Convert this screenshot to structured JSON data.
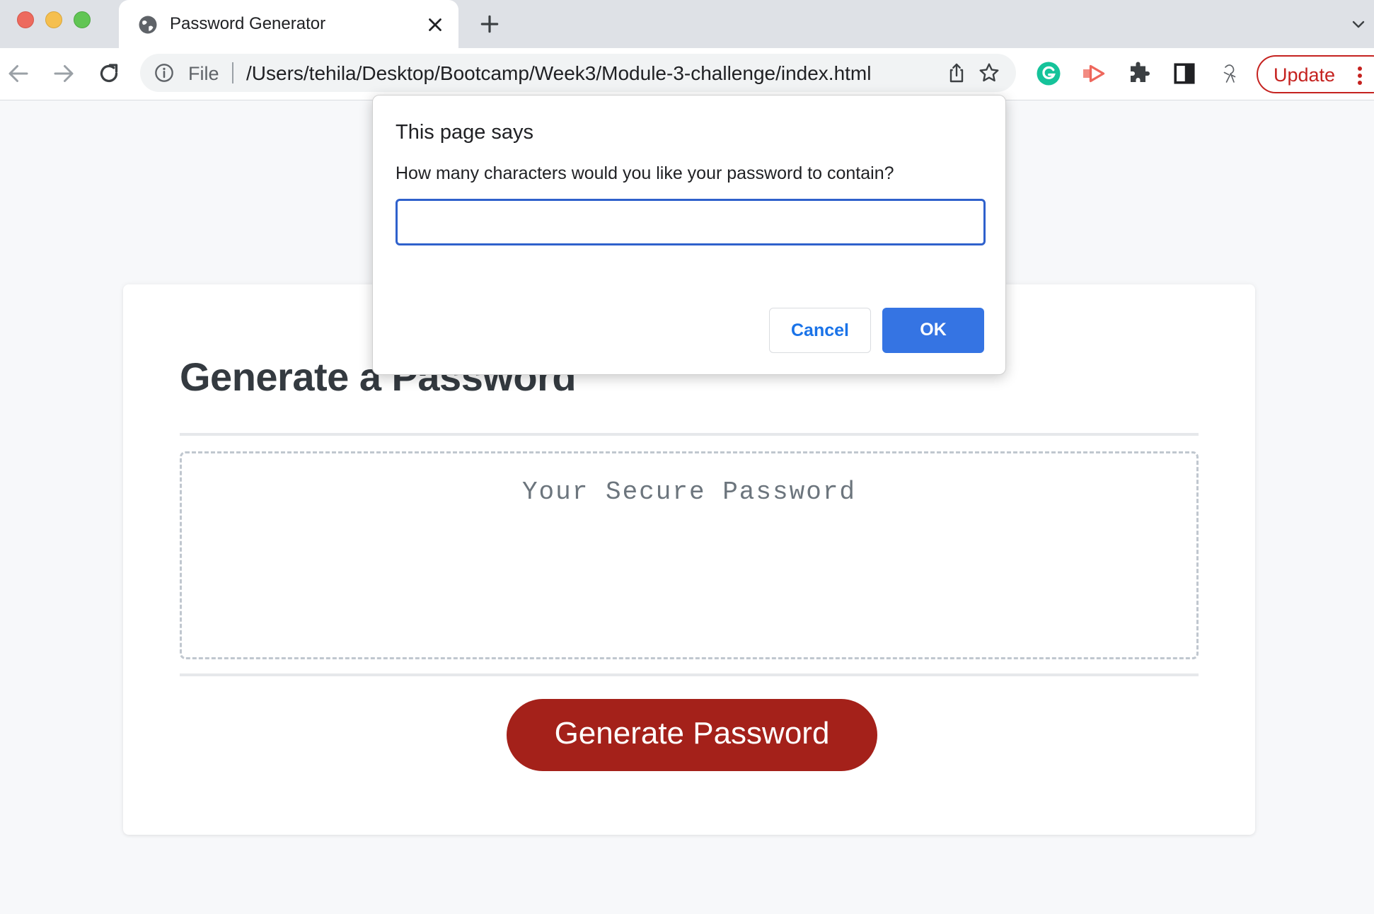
{
  "browser": {
    "tab": {
      "title": "Password Generator",
      "favicon": "globe-icon"
    },
    "omnibox": {
      "scheme_label": "File",
      "url": "/Users/tehila/Desktop/Bootcamp/Week3/Module-3-challenge/index.html"
    },
    "update_button": {
      "label": "Update",
      "color": "#c5221f"
    },
    "extensions": [
      "grammarly-icon",
      "arrow-extension-icon",
      "puzzle-icon",
      "side-panel-icon",
      "avatar-icon"
    ]
  },
  "page": {
    "title": "Generate a Password",
    "password_placeholder": "Your Secure Password",
    "generate_button_label": "Generate Password",
    "accent_color": "#a4211a"
  },
  "dialog": {
    "title": "This page says",
    "message": "How many characters would you like your password to contain?",
    "input_value": "",
    "cancel_label": "Cancel",
    "ok_label": "OK",
    "ok_color": "#3574e3"
  }
}
